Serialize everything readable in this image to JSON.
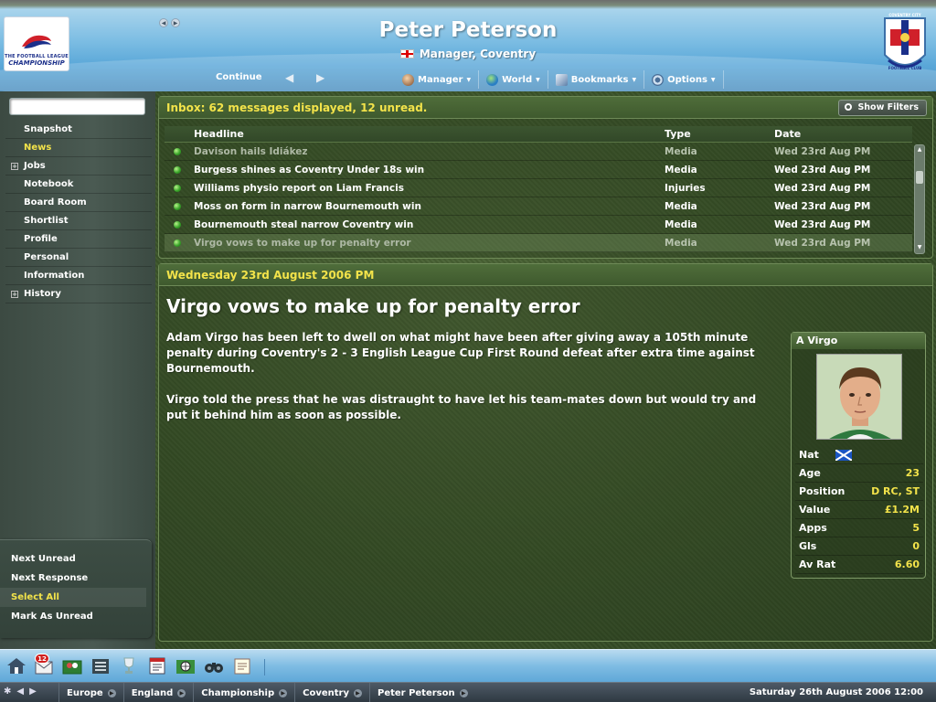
{
  "header": {
    "manager_name": "Peter Peterson",
    "manager_role": "Manager, Coventry",
    "league_logo_line1": "THE FOOTBALL LEAGUE",
    "league_logo_line2": "CHAMPIONSHIP",
    "club_crest_text": "COVENTRY CITY FOOTBALL CLUB"
  },
  "menubar": {
    "continue_label": "Continue",
    "items": [
      {
        "label": "Manager",
        "icon": "manager-icon"
      },
      {
        "label": "World",
        "icon": "globe-icon"
      },
      {
        "label": "Bookmarks",
        "icon": "bookmark-icon"
      },
      {
        "label": "Options",
        "icon": "gear-icon"
      }
    ]
  },
  "sidebar": {
    "search_value": "",
    "items": [
      {
        "label": "Snapshot",
        "expandable": false,
        "active": false
      },
      {
        "label": "News",
        "expandable": false,
        "active": true
      },
      {
        "label": "Jobs",
        "expandable": true,
        "active": false
      },
      {
        "label": "Notebook",
        "expandable": false,
        "active": false
      },
      {
        "label": "Board Room",
        "expandable": false,
        "active": false
      },
      {
        "label": "Shortlist",
        "expandable": false,
        "active": false
      },
      {
        "label": "Profile",
        "expandable": false,
        "active": false
      },
      {
        "label": "Personal",
        "expandable": false,
        "active": false
      },
      {
        "label": "Information",
        "expandable": false,
        "active": false
      },
      {
        "label": "History",
        "expandable": true,
        "active": false
      }
    ],
    "actions": [
      {
        "label": "Next Unread",
        "active": false
      },
      {
        "label": "Next Response",
        "active": false
      },
      {
        "label": "Select All",
        "active": true
      },
      {
        "label": "Mark As Unread",
        "active": false
      }
    ]
  },
  "inbox": {
    "title": "Inbox: 62 messages displayed, 12 unread.",
    "show_filters_label": "Show Filters",
    "columns": [
      "Headline",
      "Type",
      "Date"
    ],
    "rows": [
      {
        "headline": "Davison hails Idiákez",
        "type": "Media",
        "date": "Wed 23rd Aug PM",
        "read": true,
        "selected": false
      },
      {
        "headline": "Burgess shines as Coventry Under 18s win",
        "type": "Media",
        "date": "Wed 23rd Aug PM",
        "read": false,
        "selected": false
      },
      {
        "headline": "Williams physio report on Liam Francis",
        "type": "Injuries",
        "date": "Wed 23rd Aug PM",
        "read": false,
        "selected": false
      },
      {
        "headline": "Moss on form in narrow Bournemouth win",
        "type": "Media",
        "date": "Wed 23rd Aug PM",
        "read": false,
        "selected": false
      },
      {
        "headline": "Bournemouth steal narrow Coventry win",
        "type": "Media",
        "date": "Wed 23rd Aug PM",
        "read": false,
        "selected": false
      },
      {
        "headline": "Virgo vows to make up for penalty error",
        "type": "Media",
        "date": "Wed 23rd Aug PM",
        "read": true,
        "selected": true
      }
    ]
  },
  "news": {
    "date_title": "Wednesday 23rd August 2006 PM",
    "headline": "Virgo vows to make up for penalty error",
    "paragraph_1": "Adam Virgo has been left to dwell on what might have been after giving away a 105th minute penalty during Coventry's 2 - 3 English League Cup First Round defeat after extra time against Bournemouth.",
    "paragraph_2": "Virgo told the press that he was distraught to have let his team-mates down but would try and put it behind him as soon as possible."
  },
  "player_card": {
    "name": "A Virgo",
    "nationality_flag": "scotland-flag-icon",
    "stats": [
      {
        "label": "Nat",
        "value": ""
      },
      {
        "label": "Age",
        "value": "23"
      },
      {
        "label": "Position",
        "value": "D RC, ST"
      },
      {
        "label": "Value",
        "value": "£1.2M"
      },
      {
        "label": "Apps",
        "value": "5"
      },
      {
        "label": "Gls",
        "value": "0"
      },
      {
        "label": "Av Rat",
        "value": "6.60"
      }
    ]
  },
  "toolbar": {
    "inbox_badge": "12",
    "icons": [
      "home-icon",
      "inbox-icon",
      "squad-icon",
      "tactics-icon",
      "trophy-icon",
      "fixtures-icon",
      "scouting-icon",
      "binoculars-icon",
      "notes-icon"
    ]
  },
  "statusbar": {
    "crumbs": [
      "Europe",
      "England",
      "Championship",
      "Coventry",
      "Peter Peterson"
    ],
    "datetime": "Saturday 26th August 2006 12:00"
  },
  "colors": {
    "accent_yellow": "#f3e34a",
    "header_blue": "#5aa7d8",
    "panel_green": "#3f5a2e",
    "unread_dot": "#39a52a"
  }
}
